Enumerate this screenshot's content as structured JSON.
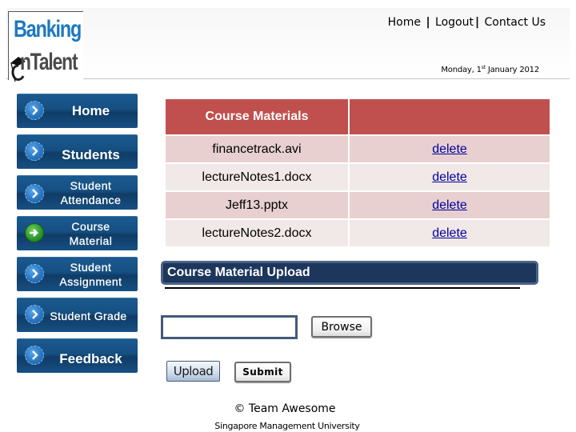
{
  "header": {
    "logo": {
      "line1": "Banking",
      "line2": "nTalent",
      "alt": "Banking On Talent"
    },
    "top_nav": [
      {
        "label": "Home"
      },
      {
        "label": "Logout"
      },
      {
        "label": "Contact Us"
      }
    ],
    "separator": "|",
    "date": {
      "prefix": "Monday, 1",
      "sup": "st",
      "suffix": " January 2012"
    }
  },
  "sidebar": {
    "items": [
      {
        "label": "Home",
        "icon": "chevron-right-icon",
        "active": false
      },
      {
        "label": "Students",
        "icon": "chevron-right-icon",
        "active": false
      },
      {
        "label": "Student Attendance",
        "line1": "Student",
        "line2": "Attendance",
        "icon": "chevron-right-icon",
        "active": false
      },
      {
        "label": "Course Material",
        "line1": "Course",
        "line2": "Material",
        "icon": "arrow-right-icon",
        "active": true
      },
      {
        "label": "Student Assignment",
        "line1": "Student",
        "line2": "Assignment",
        "icon": "chevron-right-icon",
        "active": false
      },
      {
        "label": "Student Grade",
        "icon": "chevron-right-icon",
        "active": false
      },
      {
        "label": "Feedback",
        "icon": "chevron-right-icon",
        "active": false
      }
    ]
  },
  "materials": {
    "headers": [
      "Course Materials",
      ""
    ],
    "rows": [
      {
        "file": "financetrack.avi",
        "action": "delete"
      },
      {
        "file": "lectureNotes1.docx",
        "action": "delete"
      },
      {
        "file": "Jeff13.pptx",
        "action": "delete"
      },
      {
        "file": "lectureNotes2.docx",
        "action": "delete"
      }
    ]
  },
  "upload": {
    "title": "Course Material Upload",
    "file_value": "",
    "browse_label": "Browse",
    "upload_label": "Upload",
    "submit_label": "Submit"
  },
  "footer": {
    "copyright": "© Team Awesome",
    "organization": "Singapore Management University"
  },
  "colors": {
    "table_header": "#c0504d",
    "row_odd": "#e8d0d0",
    "row_even": "#f1e8e8",
    "link": "#0000a0",
    "nav_button": "#164f82",
    "upload_bar": "#1c365c",
    "logo_blue": "#1c78bf"
  }
}
